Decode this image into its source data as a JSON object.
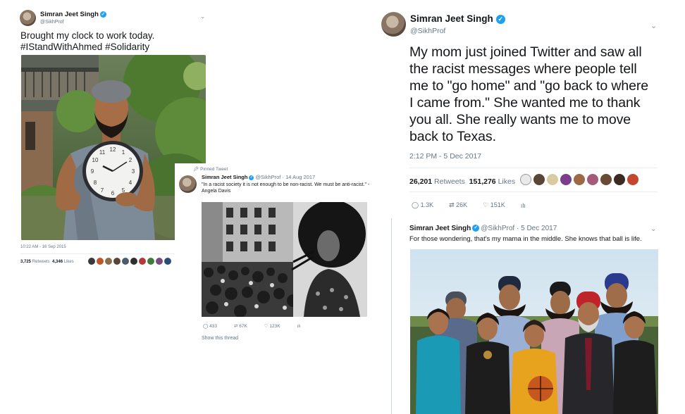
{
  "tweet_clock": {
    "name": "Simran Jeet Singh",
    "handle": "@SikhProf",
    "text_line1": "Brought my clock to work today.",
    "text_line2": "#IStandWithAhmed #Solidarity",
    "timestamp": "10:22 AM - 16 Sep 2015",
    "retweets_count": "3,725",
    "retweets_label": "Retweets",
    "likes_count": "4,346",
    "likes_label": "Likes",
    "clock_numbers": [
      "12",
      "1",
      "2",
      "3",
      "4",
      "5",
      "6",
      "7",
      "8",
      "9",
      "10",
      "11"
    ]
  },
  "tweet_pinned": {
    "pinned_label": "Pinned Tweet",
    "name": "Simran Jeet Singh",
    "handle": "@SikhProf",
    "date": "14 Aug 2017",
    "text_line1": "\"In a racist society it is not enough to be non-racist. We must be anti-racist.\" -",
    "text_line2": "Angela Davis",
    "replies": "433",
    "retweets": "67K",
    "likes": "123K",
    "show_thread": "Show this thread"
  },
  "tweet_mom": {
    "name": "Simran Jeet Singh",
    "handle": "@SikhProf",
    "text_lines": [
      "My mom just joined Twitter and saw all",
      "the racist messages where people tell",
      "me to \"go home\" and \"go back to where",
      "I came from.\" She wanted me to thank",
      "you all. She really wants me to move",
      "back to Texas."
    ],
    "timestamp": "2:12 PM - 5 Dec 2017",
    "retweets_count": "26,201",
    "retweets_label": "Retweets",
    "likes_count": "151,276",
    "likes_label": "Likes",
    "replies": "1.3K",
    "retweets": "26K",
    "likes": "151K"
  },
  "tweet_family": {
    "name": "Simran Jeet Singh",
    "handle": "@SikhProf",
    "date": "5 Dec 2017",
    "text": "For those wondering, that's my mama in the middle. She knows that ball is life."
  },
  "colors": {
    "twitter_blue": "#1da1f2",
    "muted_text": "#657786",
    "divider": "#e6ecf0"
  },
  "icons": [
    "verified-badge-icon",
    "chevron-down-icon",
    "reply-icon",
    "retweet-icon",
    "like-icon",
    "analytics-icon",
    "pin-icon"
  ]
}
